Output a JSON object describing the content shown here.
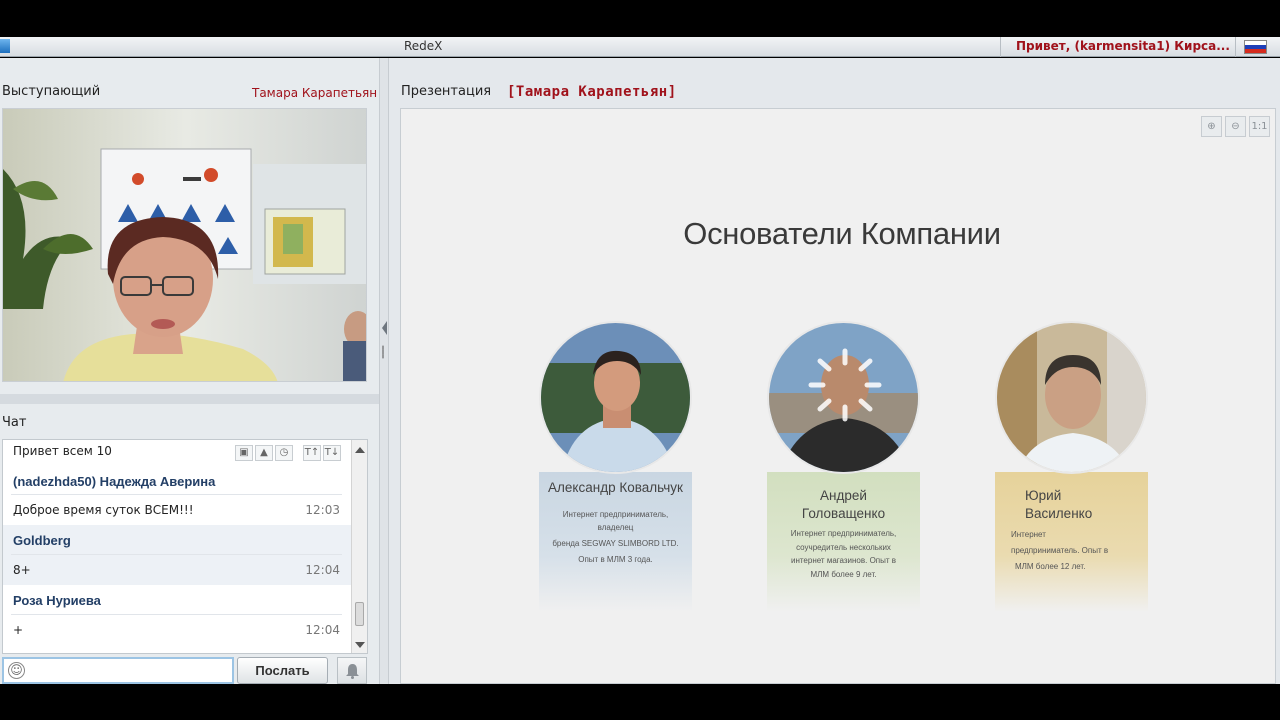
{
  "topbar": {
    "app_title": "RedeX",
    "greeting": "Привет, (karmensita1) Кирса...",
    "flag_colors": [
      "#ffffff",
      "#1f3fb8",
      "#d52b1e"
    ]
  },
  "speaker_panel": {
    "title": "Выступающий",
    "speaker_name": "Тамара Карапетьян"
  },
  "chat": {
    "title": "Чат",
    "first_line": "Привет всем 10",
    "tools": [
      "image-icon",
      "alert-icon",
      "clock-icon",
      "text-size-up-icon",
      "text-size-down-icon"
    ],
    "messages": [
      {
        "author": "(nadezhda50) Надежда  Аверина",
        "text": "Доброе время суток ВСЕМ!!!",
        "time": "12:03"
      },
      {
        "author": "Goldberg",
        "text": "8+",
        "time": "12:04"
      },
      {
        "author": "Роза Нуриева",
        "text": "+",
        "time": "12:04"
      }
    ],
    "input_value": "",
    "send_label": "Послать"
  },
  "presentation": {
    "title": "Презентация",
    "presenter": "[Тамара Карапетьян]",
    "zoom_tools": [
      "zoom-in-icon",
      "zoom-out-icon",
      "actual-size-icon"
    ],
    "slide": {
      "heading": "Основатели Компании",
      "founders": [
        {
          "name": "Александр Ковальчук",
          "bio": [
            "Интернет предприниматель,",
            "владелец",
            "бренда SEGWAY SLIMBORD LTD.",
            "Опыт в МЛМ 3 года."
          ],
          "card_color": "#c9d6e2"
        },
        {
          "name_line1": "Андрей",
          "name_line2": "Головащенко",
          "bio": [
            "Интернет предприниматель,",
            "соучредитель нескольких",
            "интернет  магазинов. Опыт в",
            "МЛМ более 9 лет."
          ],
          "card_color": "#d2dfbf"
        },
        {
          "name_line1": "Юрий",
          "name_line2": "Василенко",
          "bio": [
            "Интернет",
            "предприниматель.  Опыт в",
            "МЛМ более 12 лет."
          ],
          "card_color": "#e6d29a"
        }
      ]
    }
  }
}
